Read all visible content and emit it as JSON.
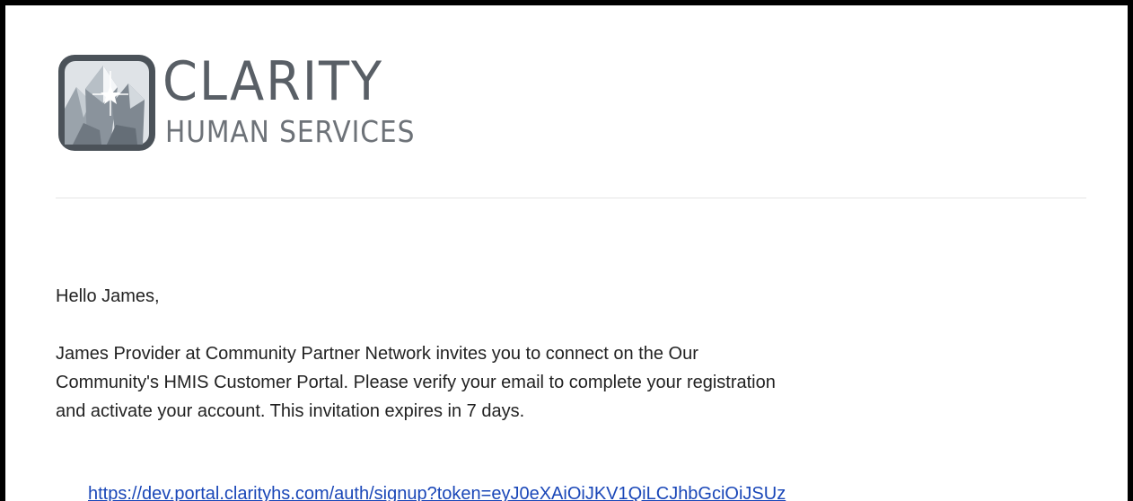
{
  "logo": {
    "name": "CLARITY",
    "tagline": "HUMAN SERVICES",
    "icon": "crystal-icon"
  },
  "email": {
    "greeting": "Hello James,",
    "body_lines": [
      "James Provider at Community Partner Network invites you to connect on the Our",
      "Community's HMIS Customer Portal. Please verify your email to complete your registration",
      "and activate your account. This invitation expires in 7 days."
    ],
    "signup_link": "https://dev.portal.clarityhs.com/auth/signup?token=eyJ0eXAiOiJKV1QiLCJhbGciOiJSUz"
  },
  "colors": {
    "frame": "#000000",
    "background": "#ffffff",
    "text": "#222222",
    "logo_text": "#595f66",
    "link": "#1a47b8",
    "divider": "#e5e5e5"
  }
}
